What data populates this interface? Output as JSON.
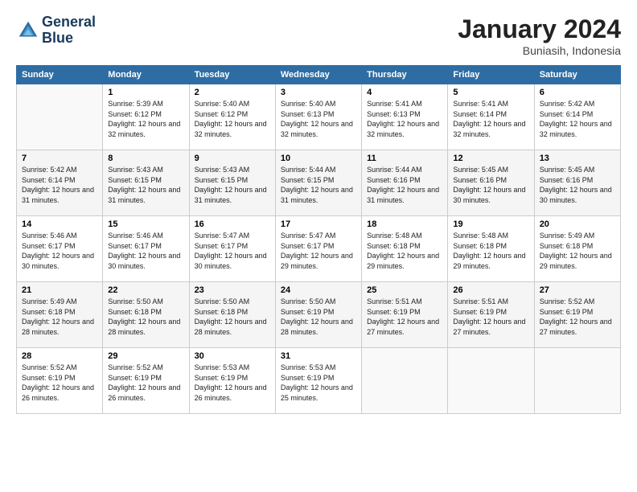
{
  "logo": {
    "line1": "General",
    "line2": "Blue"
  },
  "title": "January 2024",
  "location": "Buniasih, Indonesia",
  "days_of_week": [
    "Sunday",
    "Monday",
    "Tuesday",
    "Wednesday",
    "Thursday",
    "Friday",
    "Saturday"
  ],
  "weeks": [
    [
      {
        "day": "",
        "info": ""
      },
      {
        "day": "1",
        "info": "Sunrise: 5:39 AM\nSunset: 6:12 PM\nDaylight: 12 hours\nand 32 minutes."
      },
      {
        "day": "2",
        "info": "Sunrise: 5:40 AM\nSunset: 6:12 PM\nDaylight: 12 hours\nand 32 minutes."
      },
      {
        "day": "3",
        "info": "Sunrise: 5:40 AM\nSunset: 6:13 PM\nDaylight: 12 hours\nand 32 minutes."
      },
      {
        "day": "4",
        "info": "Sunrise: 5:41 AM\nSunset: 6:13 PM\nDaylight: 12 hours\nand 32 minutes."
      },
      {
        "day": "5",
        "info": "Sunrise: 5:41 AM\nSunset: 6:14 PM\nDaylight: 12 hours\nand 32 minutes."
      },
      {
        "day": "6",
        "info": "Sunrise: 5:42 AM\nSunset: 6:14 PM\nDaylight: 12 hours\nand 32 minutes."
      }
    ],
    [
      {
        "day": "7",
        "info": "Sunrise: 5:42 AM\nSunset: 6:14 PM\nDaylight: 12 hours\nand 31 minutes."
      },
      {
        "day": "8",
        "info": "Sunrise: 5:43 AM\nSunset: 6:15 PM\nDaylight: 12 hours\nand 31 minutes."
      },
      {
        "day": "9",
        "info": "Sunrise: 5:43 AM\nSunset: 6:15 PM\nDaylight: 12 hours\nand 31 minutes."
      },
      {
        "day": "10",
        "info": "Sunrise: 5:44 AM\nSunset: 6:15 PM\nDaylight: 12 hours\nand 31 minutes."
      },
      {
        "day": "11",
        "info": "Sunrise: 5:44 AM\nSunset: 6:16 PM\nDaylight: 12 hours\nand 31 minutes."
      },
      {
        "day": "12",
        "info": "Sunrise: 5:45 AM\nSunset: 6:16 PM\nDaylight: 12 hours\nand 30 minutes."
      },
      {
        "day": "13",
        "info": "Sunrise: 5:45 AM\nSunset: 6:16 PM\nDaylight: 12 hours\nand 30 minutes."
      }
    ],
    [
      {
        "day": "14",
        "info": "Sunrise: 5:46 AM\nSunset: 6:17 PM\nDaylight: 12 hours\nand 30 minutes."
      },
      {
        "day": "15",
        "info": "Sunrise: 5:46 AM\nSunset: 6:17 PM\nDaylight: 12 hours\nand 30 minutes."
      },
      {
        "day": "16",
        "info": "Sunrise: 5:47 AM\nSunset: 6:17 PM\nDaylight: 12 hours\nand 30 minutes."
      },
      {
        "day": "17",
        "info": "Sunrise: 5:47 AM\nSunset: 6:17 PM\nDaylight: 12 hours\nand 29 minutes."
      },
      {
        "day": "18",
        "info": "Sunrise: 5:48 AM\nSunset: 6:18 PM\nDaylight: 12 hours\nand 29 minutes."
      },
      {
        "day": "19",
        "info": "Sunrise: 5:48 AM\nSunset: 6:18 PM\nDaylight: 12 hours\nand 29 minutes."
      },
      {
        "day": "20",
        "info": "Sunrise: 5:49 AM\nSunset: 6:18 PM\nDaylight: 12 hours\nand 29 minutes."
      }
    ],
    [
      {
        "day": "21",
        "info": "Sunrise: 5:49 AM\nSunset: 6:18 PM\nDaylight: 12 hours\nand 28 minutes."
      },
      {
        "day": "22",
        "info": "Sunrise: 5:50 AM\nSunset: 6:18 PM\nDaylight: 12 hours\nand 28 minutes."
      },
      {
        "day": "23",
        "info": "Sunrise: 5:50 AM\nSunset: 6:18 PM\nDaylight: 12 hours\nand 28 minutes."
      },
      {
        "day": "24",
        "info": "Sunrise: 5:50 AM\nSunset: 6:19 PM\nDaylight: 12 hours\nand 28 minutes."
      },
      {
        "day": "25",
        "info": "Sunrise: 5:51 AM\nSunset: 6:19 PM\nDaylight: 12 hours\nand 27 minutes."
      },
      {
        "day": "26",
        "info": "Sunrise: 5:51 AM\nSunset: 6:19 PM\nDaylight: 12 hours\nand 27 minutes."
      },
      {
        "day": "27",
        "info": "Sunrise: 5:52 AM\nSunset: 6:19 PM\nDaylight: 12 hours\nand 27 minutes."
      }
    ],
    [
      {
        "day": "28",
        "info": "Sunrise: 5:52 AM\nSunset: 6:19 PM\nDaylight: 12 hours\nand 26 minutes."
      },
      {
        "day": "29",
        "info": "Sunrise: 5:52 AM\nSunset: 6:19 PM\nDaylight: 12 hours\nand 26 minutes."
      },
      {
        "day": "30",
        "info": "Sunrise: 5:53 AM\nSunset: 6:19 PM\nDaylight: 12 hours\nand 26 minutes."
      },
      {
        "day": "31",
        "info": "Sunrise: 5:53 AM\nSunset: 6:19 PM\nDaylight: 12 hours\nand 25 minutes."
      },
      {
        "day": "",
        "info": ""
      },
      {
        "day": "",
        "info": ""
      },
      {
        "day": "",
        "info": ""
      }
    ]
  ]
}
